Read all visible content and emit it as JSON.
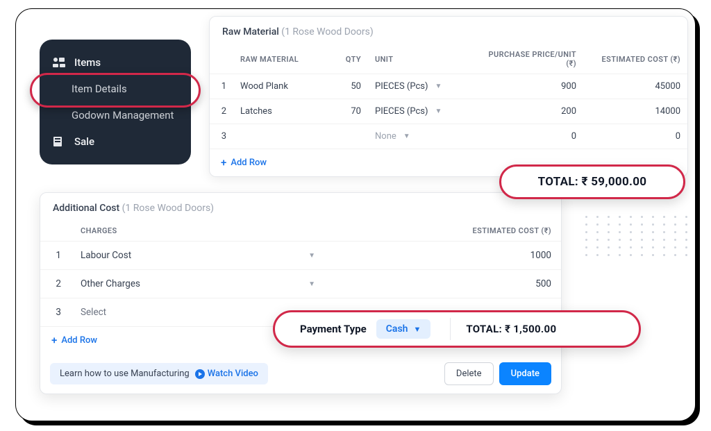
{
  "sidebar": {
    "items_label": "Items",
    "item_details": "Item Details",
    "godown": "Godown Management",
    "sale": "Sale"
  },
  "raw": {
    "title": "Raw Material",
    "subtitle": "(1 Rose Wood Doors)",
    "columns": {
      "material": "RAW MATERIAL",
      "qty": "QTY",
      "unit": "UNIT",
      "price": "PURCHASE PRICE/UNIT (₹)",
      "est": "ESTIMATED COST (₹)"
    },
    "rows": [
      {
        "idx": "1",
        "name": "Wood Plank",
        "qty": "50",
        "unit": "PIECES (Pcs)",
        "price": "900",
        "est": "45000"
      },
      {
        "idx": "2",
        "name": "Latches",
        "qty": "70",
        "unit": "PIECES (Pcs)",
        "price": "200",
        "est": "14000"
      },
      {
        "idx": "3",
        "name": "",
        "qty": "",
        "unit": "None",
        "price": "0",
        "est": "0"
      }
    ],
    "add_row": "Add Row",
    "total_label": "TOTAL: ₹ 59,000.00"
  },
  "addc": {
    "title": "Additional Cost",
    "subtitle": "(1 Rose Wood Doors)",
    "columns": {
      "charges": "CHARGES",
      "est": "ESTIMATED COST (₹)"
    },
    "rows": [
      {
        "idx": "1",
        "name": "Labour Cost",
        "est": "1000"
      },
      {
        "idx": "2",
        "name": "Other Charges",
        "est": "500"
      },
      {
        "idx": "3",
        "name": "Select",
        "est": ""
      }
    ],
    "add_row": "Add Row",
    "learn": "Learn how to use Manufacturing",
    "watch": "Watch Video",
    "delete": "Delete",
    "update": "Update"
  },
  "payment": {
    "label": "Payment Type",
    "value": "Cash",
    "total": "TOTAL: ₹ 1,500.00"
  }
}
